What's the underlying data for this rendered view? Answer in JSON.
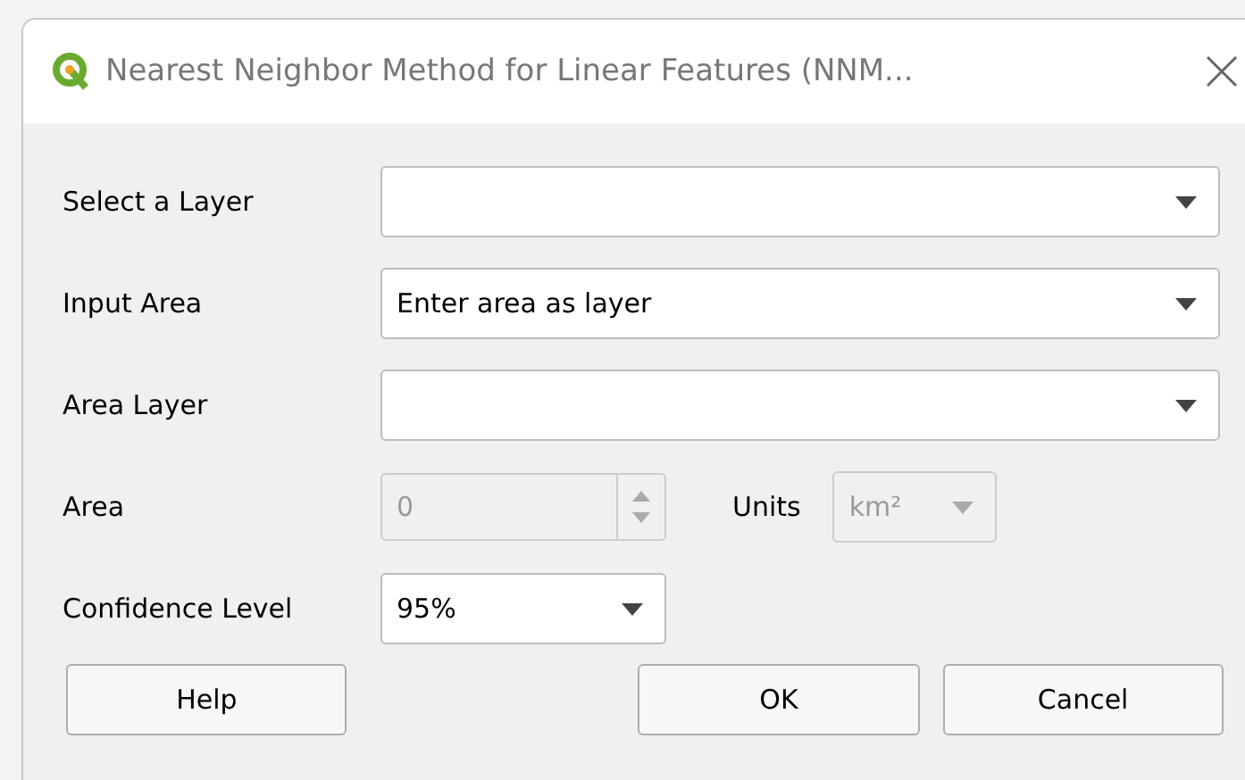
{
  "window": {
    "title": "Nearest Neighbor Method for Linear Features (NNM..."
  },
  "rows": [
    {
      "kind": "combo",
      "label": "Select a Layer",
      "value": "",
      "disabled": false
    },
    {
      "kind": "combo",
      "label": "Input Area",
      "value": "Enter area as layer",
      "disabled": false
    },
    {
      "kind": "combo",
      "label": "Area Layer",
      "value": "",
      "disabled": false
    },
    {
      "kind": "spin",
      "label": "Area",
      "value": "0",
      "disabled": true,
      "units_label": "Units",
      "units_value": "km²",
      "units_disabled": true
    },
    {
      "kind": "short_combo",
      "label": "Confidence Level",
      "value": "95%",
      "disabled": false
    }
  ],
  "buttons": [
    {
      "label": "Help",
      "kind": "left"
    },
    {
      "label": "OK",
      "kind": "right"
    },
    {
      "label": "Cancel",
      "kind": "right"
    }
  ]
}
